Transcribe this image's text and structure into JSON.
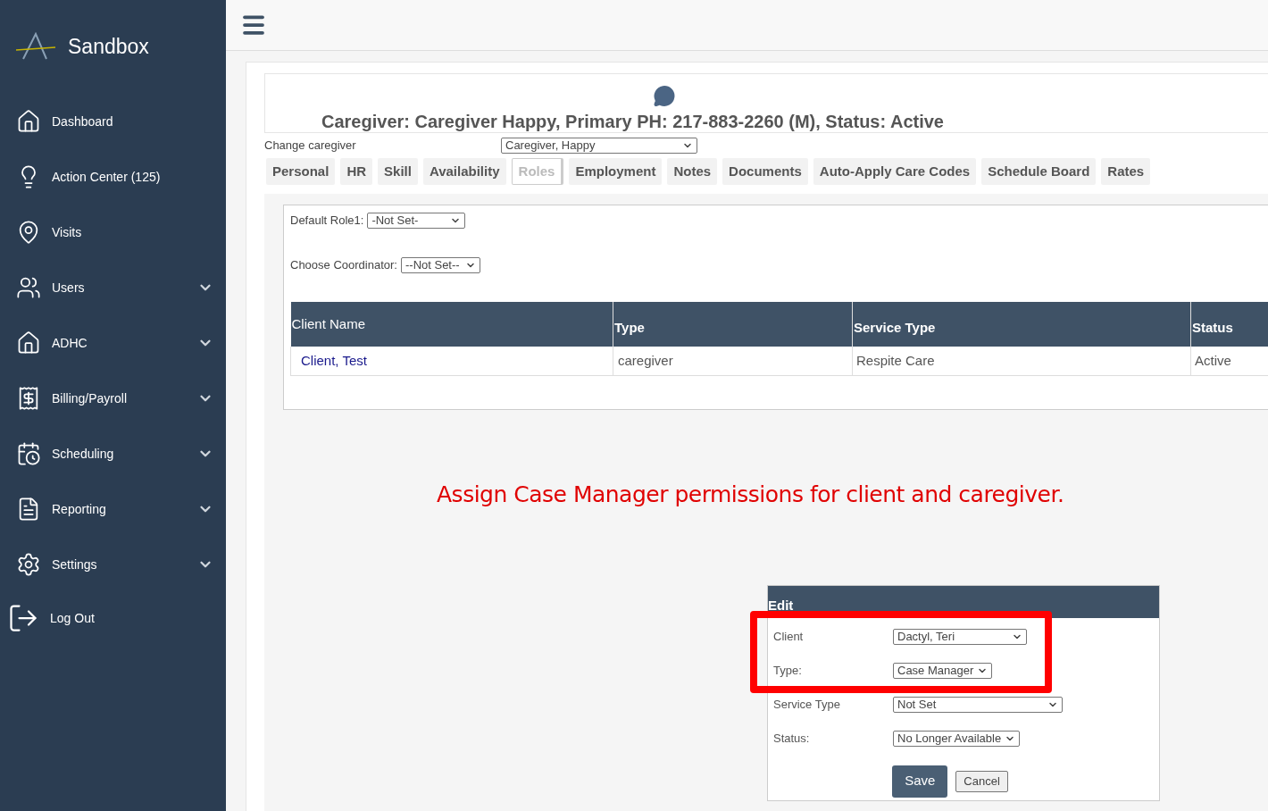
{
  "brand": {
    "title": "Sandbox"
  },
  "nav": [
    {
      "label": "Dashboard",
      "has_submenu": false
    },
    {
      "label": "Action Center (125)",
      "has_submenu": false
    },
    {
      "label": "Visits",
      "has_submenu": false
    },
    {
      "label": "Users",
      "has_submenu": true
    },
    {
      "label": "ADHC",
      "has_submenu": true
    },
    {
      "label": "Billing/Payroll",
      "has_submenu": true
    },
    {
      "label": "Scheduling",
      "has_submenu": true
    },
    {
      "label": "Reporting",
      "has_submenu": true
    },
    {
      "label": "Settings",
      "has_submenu": true
    },
    {
      "label": "Log Out",
      "has_submenu": false
    }
  ],
  "header": {
    "title": "Caregiver: Caregiver Happy, Primary PH: 217-883-2260 (M), Status: Active"
  },
  "change_caregiver": {
    "label": "Change caregiver",
    "value": "Caregiver, Happy"
  },
  "tabs": [
    {
      "label": "Personal",
      "selected": false
    },
    {
      "label": "HR",
      "selected": false
    },
    {
      "label": "Skill",
      "selected": false
    },
    {
      "label": "Availability",
      "selected": false
    },
    {
      "label": "Roles",
      "selected": true
    },
    {
      "label": "Employment",
      "selected": false
    },
    {
      "label": "Notes",
      "selected": false
    },
    {
      "label": "Documents",
      "selected": false
    },
    {
      "label": "Auto-Apply Care Codes",
      "selected": false
    },
    {
      "label": "Schedule Board",
      "selected": false
    },
    {
      "label": "Rates",
      "selected": false
    }
  ],
  "roles": {
    "default_role": {
      "label": "Default Role1:",
      "value": "-Not Set-"
    },
    "coordinator": {
      "label": "Choose Coordinator:",
      "value": "--Not Set--"
    }
  },
  "table": {
    "columns": [
      "Client Name",
      "Type",
      "Service Type",
      "Status"
    ],
    "rows": [
      {
        "client_name": "Client, Test",
        "type": "caregiver",
        "service_type": "Respite Care",
        "status": "Active"
      }
    ]
  },
  "annotation": "Assign Case Manager permissions for client and caregiver.",
  "edit": {
    "title": "Edit",
    "highlighted_fields": [
      {
        "label": "Client",
        "value": "Dactyl, Teri"
      },
      {
        "label": "Type:",
        "value": "Case Manager"
      }
    ],
    "fields": [
      {
        "label": "Service Type",
        "value": "Not Set"
      },
      {
        "label": "Status:",
        "value": "No Longer Available"
      }
    ],
    "buttons": [
      {
        "label": "Save",
        "kind": "primary"
      },
      {
        "label": "Cancel",
        "kind": "secondary"
      }
    ]
  }
}
